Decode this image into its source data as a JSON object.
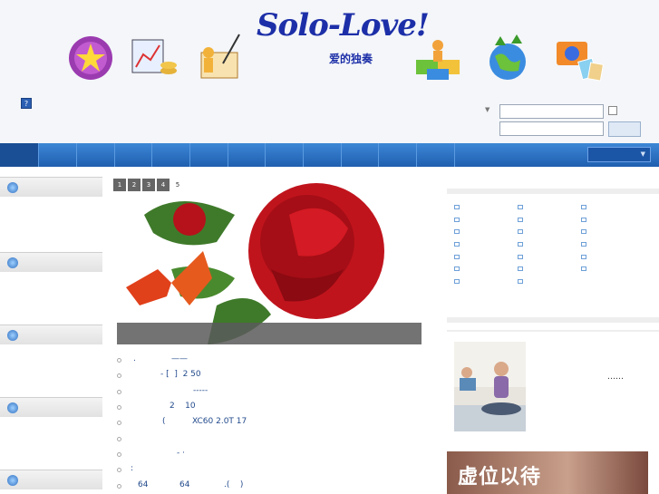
{
  "logo": {
    "title": "Solo-Love!",
    "subtitle": "爱的独奏"
  },
  "header": {
    "help_label": "?"
  },
  "slider": {
    "pages": [
      "1",
      "2",
      "3",
      "4",
      "5"
    ],
    "current": "5"
  },
  "news": [
    {
      "a": ".",
      "b": "——"
    },
    {
      "a": "- [  ]  2 50",
      "b": ""
    },
    {
      "a": "",
      "b": "-----"
    },
    {
      "a": "2    10",
      "b": ""
    },
    {
      "a": "(",
      "b": "XC60 2.0T 17"
    },
    {
      "a": "",
      "b": ""
    },
    {
      "a": "- ·",
      "b": ""
    },
    {
      "a": ":",
      "b": ""
    },
    {
      "a": "64",
      "b": "64",
      "c": ".(    )"
    }
  ],
  "right": {
    "ellipsis": "……",
    "banner_text": "虚位以待"
  },
  "colors": {
    "nav": "#2a70c4",
    "logo": "#1d2fa8"
  }
}
